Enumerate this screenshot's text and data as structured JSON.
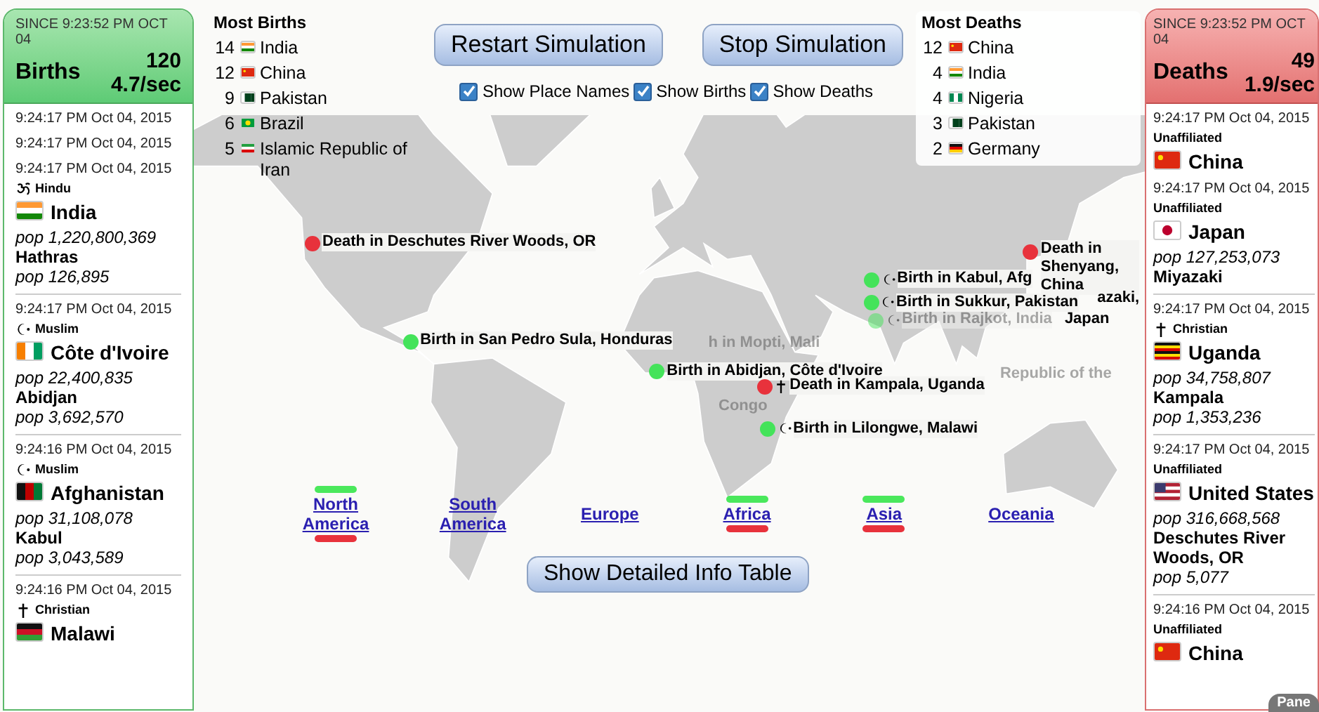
{
  "births_panel": {
    "since": "SINCE 9:23:52 PM OCT 04",
    "title": "Births",
    "count": "120",
    "rate": "4.7/sec",
    "entries": [
      {
        "time": "9:24:17 PM Oct 04, 2015"
      },
      {
        "time": "9:24:17 PM Oct 04, 2015"
      },
      {
        "time": "9:24:17 PM Oct 04, 2015",
        "religion": {
          "kind": "hindu",
          "label": "Hindu"
        },
        "country": "India",
        "flag": {
          "kind": "india"
        },
        "country_pop": "pop 1,220,800,369",
        "city": "Hathras",
        "city_pop": "pop 126,895"
      },
      {
        "time": "9:24:17 PM Oct 04, 2015",
        "religion": {
          "kind": "muslim",
          "label": "Muslim"
        },
        "country": "Côte d'Ivoire",
        "flag": {
          "kind": "ivory-coast"
        },
        "country_pop": "pop 22,400,835",
        "city": "Abidjan",
        "city_pop": "pop 3,692,570"
      },
      {
        "time": "9:24:16 PM Oct 04, 2015",
        "religion": {
          "kind": "muslim",
          "label": "Muslim"
        },
        "country": "Afghanistan",
        "flag": {
          "kind": "afghanistan"
        },
        "country_pop": "pop 31,108,078",
        "city": "Kabul",
        "city_pop": "pop 3,043,589"
      },
      {
        "time": "9:24:16 PM Oct 04, 2015",
        "religion": {
          "kind": "christian",
          "label": "Christian"
        },
        "country": "Malawi",
        "flag": {
          "kind": "malawi"
        }
      }
    ]
  },
  "most_births": {
    "title": "Most Births",
    "items": [
      {
        "count": "14",
        "country": "India",
        "flag": {
          "kind": "india"
        }
      },
      {
        "count": "12",
        "country": "China",
        "flag": {
          "kind": "china"
        }
      },
      {
        "count": "9",
        "country": "Pakistan",
        "flag": {
          "kind": "pakistan"
        }
      },
      {
        "count": "6",
        "country": "Brazil",
        "flag": {
          "kind": "brazil"
        }
      },
      {
        "count": "5",
        "country": "Islamic Republic of Iran",
        "flag": {
          "kind": "iran"
        }
      }
    ]
  },
  "controls": {
    "buttons": [
      "Restart Simulation",
      "Stop Simulation"
    ],
    "checkboxes": [
      {
        "label": "Show Place Names",
        "checked": true
      },
      {
        "label": "Show Births",
        "checked": true
      },
      {
        "label": "Show Deaths",
        "checked": true
      }
    ]
  },
  "most_deaths": {
    "title": "Most Deaths",
    "items": [
      {
        "count": "12",
        "country": "China",
        "flag": {
          "kind": "china"
        }
      },
      {
        "count": "4",
        "country": "India",
        "flag": {
          "kind": "india"
        }
      },
      {
        "count": "4",
        "country": "Nigeria",
        "flag": {
          "kind": "nigeria"
        }
      },
      {
        "count": "3",
        "country": "Pakistan",
        "flag": {
          "kind": "pakistan"
        }
      },
      {
        "count": "2",
        "country": "Germany",
        "flag": {
          "kind": "germany"
        }
      }
    ]
  },
  "map_markers": [
    {
      "kind": "death",
      "label": "Death in Deschutes River Woods, OR",
      "faded": false
    },
    {
      "kind": "death",
      "label": "Death in Shenyang, China",
      "faded": false
    },
    {
      "kind": "text",
      "label": "azaki,",
      "faded": false
    },
    {
      "kind": "text",
      "label": "Japan",
      "faded": false
    },
    {
      "kind": "birth",
      "religion": {
        "kind": "muslim"
      },
      "label": "Birth in Kabul, Afg",
      "faded": false
    },
    {
      "kind": "birth",
      "religion": {
        "kind": "muslim"
      },
      "label": "Birth in Sukkur, Pakistan",
      "faded": false
    },
    {
      "kind": "birth",
      "religion": {
        "kind": "muslim"
      },
      "label": "Birth in Rajkot, India",
      "faded": true
    },
    {
      "kind": "birth",
      "label": "Birth in San Pedro Sula, Honduras",
      "faded": false
    },
    {
      "kind": "text",
      "label": "h in Mopti, Mali",
      "faded": true
    },
    {
      "kind": "birth",
      "label": "Birth in Abidjan, Côte d'Ivoire",
      "faded": false
    },
    {
      "kind": "death",
      "religion": {
        "kind": "christian"
      },
      "label": "Death in Kampala, Uganda",
      "faded": false
    },
    {
      "kind": "text",
      "label": "Republic of the",
      "faded": true
    },
    {
      "kind": "text",
      "label": "Congo",
      "faded": true
    },
    {
      "kind": "birth",
      "religion": {
        "kind": "muslim"
      },
      "label": "Birth in Lilongwe, Malawi",
      "faded": false
    }
  ],
  "continents": [
    {
      "label": "North America",
      "births": true,
      "deaths": true
    },
    {
      "label": "South America",
      "births": false,
      "deaths": false
    },
    {
      "label": "Europe",
      "births": false,
      "deaths": false
    },
    {
      "label": "Africa",
      "births": true,
      "deaths": true
    },
    {
      "label": "Asia",
      "births": true,
      "deaths": true
    },
    {
      "label": "Oceania",
      "births": false,
      "deaths": false
    }
  ],
  "info_button": "Show Detailed Info Table",
  "deaths_panel": {
    "since": "SINCE 9:23:52 PM OCT 04",
    "title": "Deaths",
    "count": "49",
    "rate": "1.9/sec",
    "entries": [
      {
        "time": "9:24:17 PM Oct 04, 2015",
        "religion": {
          "kind": "none",
          "label": "Unaffiliated"
        },
        "country": "China",
        "flag": {
          "kind": "china"
        }
      },
      {
        "time": "9:24:17 PM Oct 04, 2015",
        "religion": {
          "kind": "none",
          "label": "Unaffiliated"
        },
        "country": "Japan",
        "flag": {
          "kind": "japan"
        },
        "country_pop": "pop 127,253,073",
        "city": "Miyazaki"
      },
      {
        "time": "9:24:17 PM Oct 04, 2015",
        "religion": {
          "kind": "christian",
          "label": "Christian"
        },
        "country": "Uganda",
        "flag": {
          "kind": "uganda"
        },
        "country_pop": "pop 34,758,807",
        "city": "Kampala",
        "city_pop": "pop 1,353,236"
      },
      {
        "time": "9:24:17 PM Oct 04, 2015",
        "religion": {
          "kind": "none",
          "label": "Unaffiliated"
        },
        "country": "United States",
        "flag": {
          "kind": "usa"
        },
        "country_pop": "pop 316,668,568",
        "city": "Deschutes River Woods, OR",
        "city_pop": "pop 5,077"
      },
      {
        "time": "9:24:16 PM Oct 04, 2015",
        "religion": {
          "kind": "none",
          "label": "Unaffiliated"
        },
        "country": "China",
        "flag": {
          "kind": "china"
        }
      }
    ]
  },
  "panel_tab": "Pane"
}
